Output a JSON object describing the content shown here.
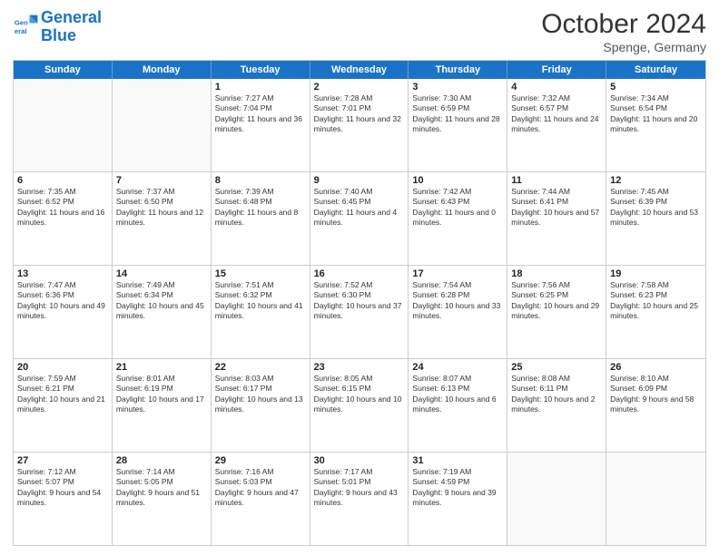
{
  "logo": {
    "line1": "General",
    "line2": "Blue"
  },
  "header": {
    "month": "October 2024",
    "location": "Spenge, Germany"
  },
  "days": [
    "Sunday",
    "Monday",
    "Tuesday",
    "Wednesday",
    "Thursday",
    "Friday",
    "Saturday"
  ],
  "weeks": [
    [
      {
        "day": "",
        "content": ""
      },
      {
        "day": "",
        "content": ""
      },
      {
        "day": "1",
        "content": "Sunrise: 7:27 AM\nSunset: 7:04 PM\nDaylight: 11 hours and 36 minutes."
      },
      {
        "day": "2",
        "content": "Sunrise: 7:28 AM\nSunset: 7:01 PM\nDaylight: 11 hours and 32 minutes."
      },
      {
        "day": "3",
        "content": "Sunrise: 7:30 AM\nSunset: 6:59 PM\nDaylight: 11 hours and 28 minutes."
      },
      {
        "day": "4",
        "content": "Sunrise: 7:32 AM\nSunset: 6:57 PM\nDaylight: 11 hours and 24 minutes."
      },
      {
        "day": "5",
        "content": "Sunrise: 7:34 AM\nSunset: 6:54 PM\nDaylight: 11 hours and 20 minutes."
      }
    ],
    [
      {
        "day": "6",
        "content": "Sunrise: 7:35 AM\nSunset: 6:52 PM\nDaylight: 11 hours and 16 minutes."
      },
      {
        "day": "7",
        "content": "Sunrise: 7:37 AM\nSunset: 6:50 PM\nDaylight: 11 hours and 12 minutes."
      },
      {
        "day": "8",
        "content": "Sunrise: 7:39 AM\nSunset: 6:48 PM\nDaylight: 11 hours and 8 minutes."
      },
      {
        "day": "9",
        "content": "Sunrise: 7:40 AM\nSunset: 6:45 PM\nDaylight: 11 hours and 4 minutes."
      },
      {
        "day": "10",
        "content": "Sunrise: 7:42 AM\nSunset: 6:43 PM\nDaylight: 11 hours and 0 minutes."
      },
      {
        "day": "11",
        "content": "Sunrise: 7:44 AM\nSunset: 6:41 PM\nDaylight: 10 hours and 57 minutes."
      },
      {
        "day": "12",
        "content": "Sunrise: 7:45 AM\nSunset: 6:39 PM\nDaylight: 10 hours and 53 minutes."
      }
    ],
    [
      {
        "day": "13",
        "content": "Sunrise: 7:47 AM\nSunset: 6:36 PM\nDaylight: 10 hours and 49 minutes."
      },
      {
        "day": "14",
        "content": "Sunrise: 7:49 AM\nSunset: 6:34 PM\nDaylight: 10 hours and 45 minutes."
      },
      {
        "day": "15",
        "content": "Sunrise: 7:51 AM\nSunset: 6:32 PM\nDaylight: 10 hours and 41 minutes."
      },
      {
        "day": "16",
        "content": "Sunrise: 7:52 AM\nSunset: 6:30 PM\nDaylight: 10 hours and 37 minutes."
      },
      {
        "day": "17",
        "content": "Sunrise: 7:54 AM\nSunset: 6:28 PM\nDaylight: 10 hours and 33 minutes."
      },
      {
        "day": "18",
        "content": "Sunrise: 7:56 AM\nSunset: 6:25 PM\nDaylight: 10 hours and 29 minutes."
      },
      {
        "day": "19",
        "content": "Sunrise: 7:58 AM\nSunset: 6:23 PM\nDaylight: 10 hours and 25 minutes."
      }
    ],
    [
      {
        "day": "20",
        "content": "Sunrise: 7:59 AM\nSunset: 6:21 PM\nDaylight: 10 hours and 21 minutes."
      },
      {
        "day": "21",
        "content": "Sunrise: 8:01 AM\nSunset: 6:19 PM\nDaylight: 10 hours and 17 minutes."
      },
      {
        "day": "22",
        "content": "Sunrise: 8:03 AM\nSunset: 6:17 PM\nDaylight: 10 hours and 13 minutes."
      },
      {
        "day": "23",
        "content": "Sunrise: 8:05 AM\nSunset: 6:15 PM\nDaylight: 10 hours and 10 minutes."
      },
      {
        "day": "24",
        "content": "Sunrise: 8:07 AM\nSunset: 6:13 PM\nDaylight: 10 hours and 6 minutes."
      },
      {
        "day": "25",
        "content": "Sunrise: 8:08 AM\nSunset: 6:11 PM\nDaylight: 10 hours and 2 minutes."
      },
      {
        "day": "26",
        "content": "Sunrise: 8:10 AM\nSunset: 6:09 PM\nDaylight: 9 hours and 58 minutes."
      }
    ],
    [
      {
        "day": "27",
        "content": "Sunrise: 7:12 AM\nSunset: 5:07 PM\nDaylight: 9 hours and 54 minutes."
      },
      {
        "day": "28",
        "content": "Sunrise: 7:14 AM\nSunset: 5:05 PM\nDaylight: 9 hours and 51 minutes."
      },
      {
        "day": "29",
        "content": "Sunrise: 7:16 AM\nSunset: 5:03 PM\nDaylight: 9 hours and 47 minutes."
      },
      {
        "day": "30",
        "content": "Sunrise: 7:17 AM\nSunset: 5:01 PM\nDaylight: 9 hours and 43 minutes."
      },
      {
        "day": "31",
        "content": "Sunrise: 7:19 AM\nSunset: 4:59 PM\nDaylight: 9 hours and 39 minutes."
      },
      {
        "day": "",
        "content": ""
      },
      {
        "day": "",
        "content": ""
      }
    ]
  ]
}
